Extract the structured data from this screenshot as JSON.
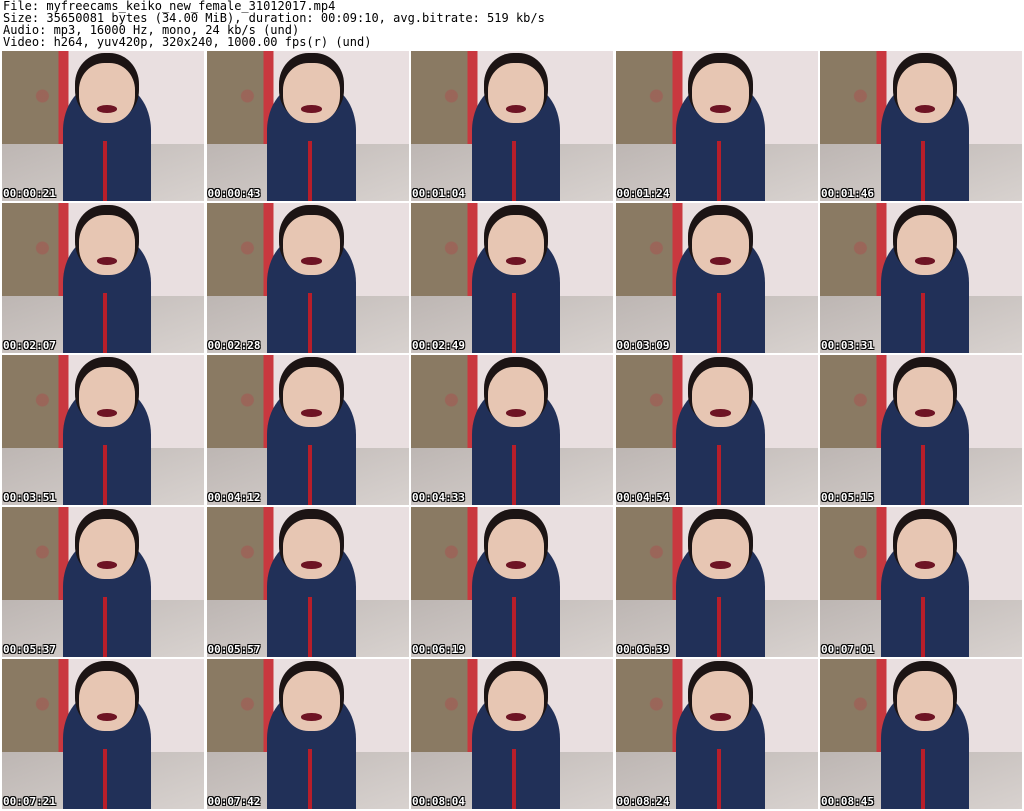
{
  "header": {
    "file": "File: myfreecams_keiko_new_female_31012017.mp4",
    "size": "Size: 35650081 bytes (34.00 MiB), duration: 00:09:10, avg.bitrate: 519 kb/s",
    "audio": "Audio: mp3, 16000 Hz, mono, 24 kb/s (und)",
    "video": "Video: h264, yuv420p, 320x240, 1000.00 fps(r) (und)"
  },
  "thumbnails": [
    {
      "timestamp": "00:00:21"
    },
    {
      "timestamp": "00:00:43"
    },
    {
      "timestamp": "00:01:04"
    },
    {
      "timestamp": "00:01:24"
    },
    {
      "timestamp": "00:01:46"
    },
    {
      "timestamp": "00:02:07"
    },
    {
      "timestamp": "00:02:28"
    },
    {
      "timestamp": "00:02:49"
    },
    {
      "timestamp": "00:03:09"
    },
    {
      "timestamp": "00:03:31"
    },
    {
      "timestamp": "00:03:51"
    },
    {
      "timestamp": "00:04:12"
    },
    {
      "timestamp": "00:04:33"
    },
    {
      "timestamp": "00:04:54"
    },
    {
      "timestamp": "00:05:15"
    },
    {
      "timestamp": "00:05:37"
    },
    {
      "timestamp": "00:05:57"
    },
    {
      "timestamp": "00:06:19"
    },
    {
      "timestamp": "00:06:39"
    },
    {
      "timestamp": "00:07:01"
    },
    {
      "timestamp": "00:07:21"
    },
    {
      "timestamp": "00:07:42"
    },
    {
      "timestamp": "00:08:04"
    },
    {
      "timestamp": "00:08:24"
    },
    {
      "timestamp": "00:08:45"
    }
  ]
}
